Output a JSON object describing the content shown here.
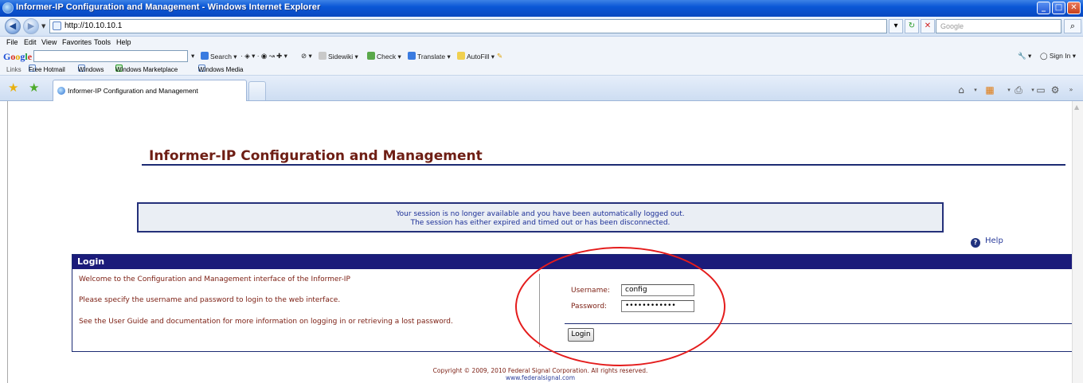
{
  "window": {
    "title": "Informer-IP Configuration and Management - Windows Internet Explorer",
    "buttons": {
      "minimize": "_",
      "maximize": "□",
      "close": "✕"
    }
  },
  "address": {
    "url": "http://10.10.10.1",
    "search_placeholder": "Google"
  },
  "menu": [
    "File",
    "Edit",
    "View",
    "Favorites",
    "Tools",
    "Help"
  ],
  "google_toolbar": {
    "logo": [
      "G",
      "o",
      "o",
      "g",
      "l",
      "e"
    ],
    "search_label": "Search",
    "sidewiki_label": "Sidewiki",
    "check_label": "Check",
    "translate_label": "Translate",
    "autofill_label": "AutoFill",
    "signin_label": "Sign In"
  },
  "links": {
    "label": "Links",
    "items": [
      "Free Hotmail",
      "Windows",
      "Windows Marketplace",
      "Windows Media"
    ]
  },
  "tabs": {
    "active_label": "Informer-IP Configuration and Management"
  },
  "page": {
    "title": "Informer-IP Configuration and Management",
    "session_line1": "Your session is no longer available and you have been automatically logged out.",
    "session_line2": "The session has either expired and timed out or has been disconnected.",
    "help_label": "Help",
    "login": {
      "header": "Login",
      "welcome": "Welcome to the Configuration and Management interface of the Informer-IP",
      "instruction": "Please specify the username and password to login to the web interface.",
      "guide": "See the User Guide and documentation for more information on logging in or retrieving a lost password.",
      "username_label": "Username:",
      "username_value": "config",
      "password_label": "Password:",
      "password_value": "••••••••••••",
      "button_label": "Login"
    },
    "copyright": "Copyright © 2009, 2010 Federal Signal Corporation. All rights reserved.",
    "website": "www.federalsignal.com"
  },
  "colors": {
    "title_maroon": "#6e1e14",
    "navy": "#1b1b7a",
    "annotation_red": "#e41c1c"
  }
}
